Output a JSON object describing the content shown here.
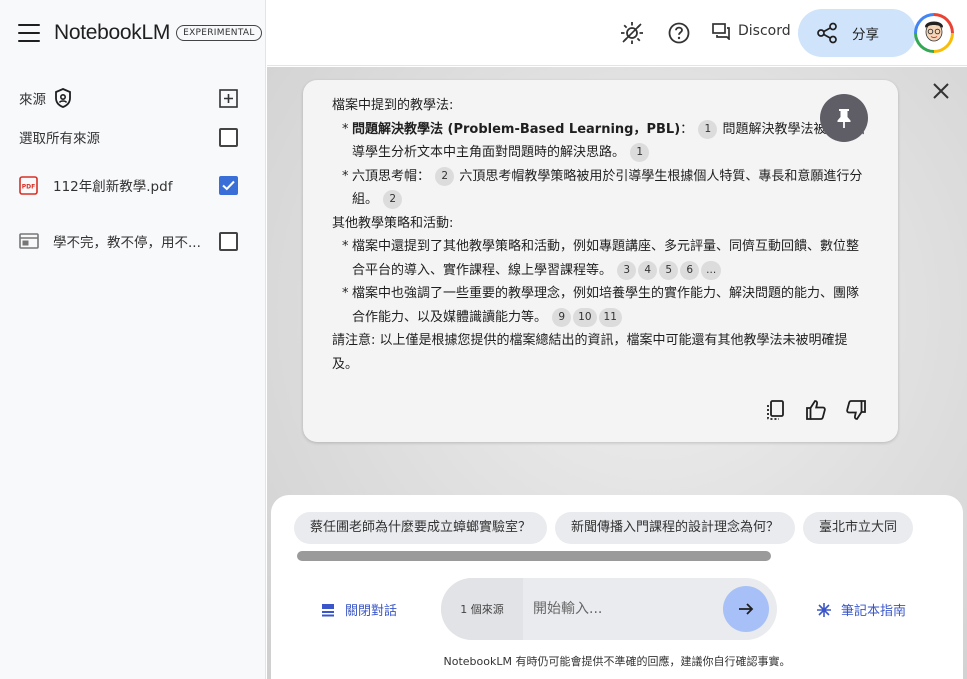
{
  "app": {
    "brand": "NotebookLM",
    "badge": "EXPERIMENTAL"
  },
  "sidebar": {
    "sources_label": "來源",
    "select_all_label": "選取所有來源",
    "sources": [
      {
        "name": "112年創新教學.pdf",
        "icon": "pdf-icon",
        "checked": true
      },
      {
        "name": "學不完，教不停，用不...",
        "icon": "web-page-icon",
        "checked": false
      }
    ]
  },
  "header": {
    "discord_label": "Discord",
    "share_label": "分享"
  },
  "answer": {
    "heading1": "檔案中提到的教學法:",
    "b1_term": "問題解決教學法 (Problem-Based Learning，PBL)",
    "b1_colon": "：",
    "b1_cite1": "1",
    "b1_text": "問題解決教學法被用於引導學生分析文本中主角面對問題時的解決思路。",
    "b1_cite2": "1",
    "b2_term": "六頂思考帽",
    "b2_colon": "：",
    "b2_cite1": "2",
    "b2_text": "六頂思考帽教學策略被用於引導學生根據個人特質、專長和意願進行分組。",
    "b2_cite2": "2",
    "heading2": "其他教學策略和活動:",
    "b3_text": "檔案中還提到了其他教學策略和活動，例如專題講座、多元評量、同儕互動回饋、數位整合平台的導入、實作課程、線上學習課程等。",
    "b3_cites": [
      "3",
      "4",
      "5",
      "6",
      "..."
    ],
    "b4_text": "檔案中也強調了一些重要的教學理念，例如培養學生的實作能力、解決問題的能力、團隊合作能力、以及媒體識讀能力等。",
    "b4_cites": [
      "9",
      "10",
      "11"
    ],
    "note": "請注意: 以上僅是根據您提供的檔案總結出的資訊，檔案中可能還有其他教學法未被明確提及。"
  },
  "suggestions": [
    "蔡任圃老師為什麼要成立蟑螂實驗室？",
    "新聞傳播入門課程的設計理念為何？",
    "臺北市立大同"
  ],
  "chat": {
    "close_chat_label": "關閉對話",
    "source_count": "1 個來源",
    "placeholder": "開始輸入...",
    "guide_label": "筆記本指南",
    "disclaimer": "NotebookLM 有時仍可能會提供不準確的回應，建議你自行確認事實。"
  },
  "colors": {
    "accent": "#3a56c8",
    "checkbox": "#3b6fd8",
    "share_bg": "#cfe3fb",
    "send_bg": "#a7c0f7",
    "pin_bg": "#5f5d66"
  }
}
